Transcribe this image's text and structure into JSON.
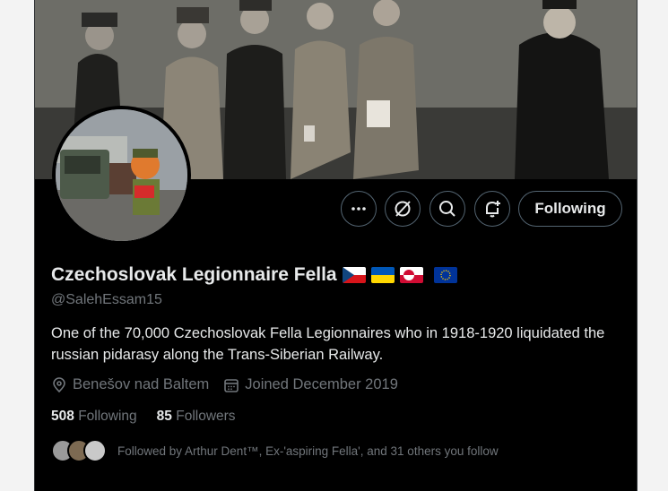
{
  "profile": {
    "display_name": "Czechoslovak Legionnaire Fella",
    "flags": [
      "czech-flag",
      "ukraine-flag",
      "greenland-flag",
      "eu-flag"
    ],
    "handle": "@SalehEssam15",
    "bio": "One of the 70,000 Czechoslovak Fella Legionnaires who in 1918-1920 liquidated the russian pidarasy along the Trans-Siberian Railway.",
    "location": "Benešov nad Baltem",
    "joined": "Joined December 2019",
    "following_count": "508",
    "following_label": "Following",
    "followers_count": "85",
    "followers_label": "Followers",
    "followed_by": "Followed by Arthur Dent™, Ex-'aspiring Fella', and 31 others you follow"
  },
  "actions": {
    "more_icon": "more-icon",
    "grok_icon": "grok-icon",
    "search_icon": "search-icon",
    "notify_icon": "bell-plus-icon",
    "follow_label": "Following"
  },
  "colors": {
    "background": "#000000",
    "text_primary": "#e7e9ea",
    "text_secondary": "#71767b",
    "border": "#536471"
  }
}
